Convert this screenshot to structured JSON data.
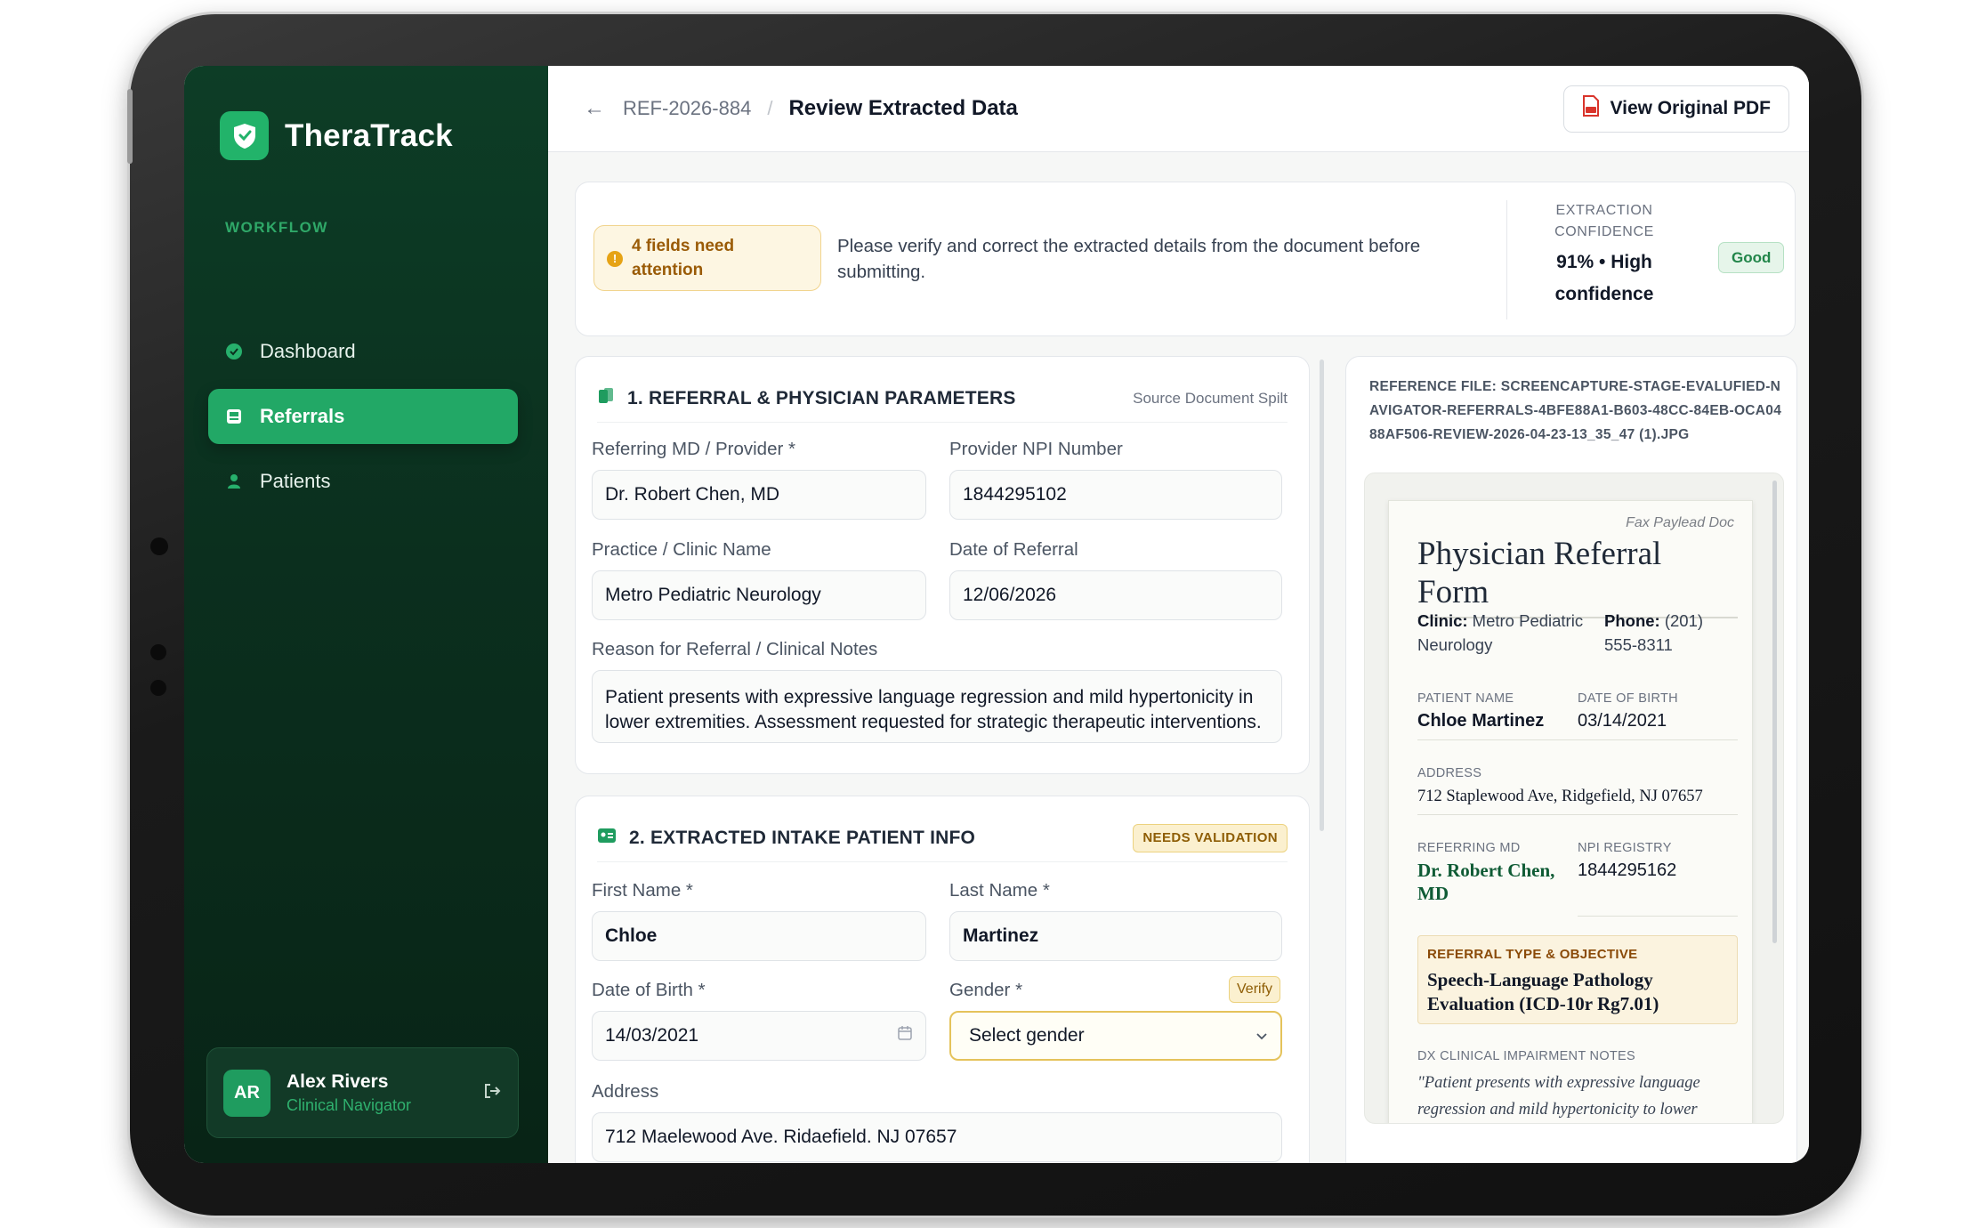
{
  "app": {
    "name": "TheraTrack"
  },
  "nav": {
    "section_label": "WORKFLOW",
    "items": [
      {
        "label": "Dashboard",
        "icon": "check-circle-icon"
      },
      {
        "label": "Referrals",
        "icon": "inbox-icon",
        "active": true
      },
      {
        "label": "Patients",
        "icon": "user-icon"
      }
    ]
  },
  "user": {
    "initials": "AR",
    "name": "Alex Rivers",
    "role": "Clinical Navigator"
  },
  "header": {
    "ref_id": "REF-2026-884",
    "separator": "/",
    "title": "Review Extracted Data",
    "pdf_button": "View Original PDF"
  },
  "alert": {
    "badge": "4 fields need attention",
    "message": "Please verify and correct the extracted details from the document before submitting.",
    "confidence_label": "EXTRACTION CONFIDENCE",
    "confidence_value": "91% • High confidence",
    "confidence_badge": "Good"
  },
  "section1": {
    "title": "1. REFERRAL & PHYSICIAN PARAMETERS",
    "note": "Source Document Spilt",
    "fields": {
      "referring_md_label": "Referring MD / Provider *",
      "referring_md_value": "Dr. Robert Chen, MD",
      "npi_label": "Provider NPI Number",
      "npi_value": "1844295102",
      "practice_label": "Practice / Clinic Name",
      "practice_value": "Metro Pediatric Neurology",
      "date_label": "Date of Referral",
      "date_value": "12/06/2026",
      "reason_label": "Reason for Referral / Clinical Notes",
      "reason_value": "Patient presents with expressive language regression and mild hypertonicity in lower extremities. Assessment requested for strategic therapeutic interventions."
    }
  },
  "section2": {
    "title": "2. EXTRACTED INTAKE PATIENT INFO",
    "badge": "NEEDS VALIDATION",
    "fields": {
      "first_name_label": "First Name *",
      "first_name_value": "Chloe",
      "last_name_label": "Last Name *",
      "last_name_value": "Martinez",
      "dob_label": "Date of Birth *",
      "dob_value": "14/03/2021",
      "gender_label": "Gender *",
      "gender_verify": "Verify",
      "gender_placeholder": "Select gender",
      "address_label": "Address",
      "address_value": "712 Maelewood Ave. Ridaefield. NJ 07657"
    }
  },
  "reference": {
    "file": "REFERENCE FILE: SCREENCAPTURE-STAGE-EVALUFIED-NAVIGATOR-REFERRALS-4BFE88A1-B603-48CC-84EB-OCA0488AF506-REVIEW-2026-04-23-13_35_47 (1).JPG",
    "doc": {
      "tag": "Fax Paylead Doc",
      "title": "Physician Referral Form",
      "clinic_label": "Clinic:",
      "clinic_value": "Metro Pediatric Neurology",
      "phone_label": "Phone:",
      "phone_value": "(201) 555-8311",
      "patient_name_label": "PATIENT NAME",
      "patient_name_value": "Chloe Martinez",
      "dob_label": "DATE OF BIRTH",
      "dob_value": "03/14/2021",
      "address_label": "ADDRESS",
      "address_value": "712 Staplewood Ave, Ridgefield, NJ 07657",
      "referring_label": "REFERRING MD",
      "referring_value": "Dr. Robert Chen, MD",
      "npi_label": "NPI REGISTRY",
      "npi_value": "1844295162",
      "type_label": "REFERRAL TYPE & OBJECTIVE",
      "type_value": "Speech-Language Pathology Evaluation (ICD-10r Rg7.01)",
      "notes_label": "DX CLINICAL IMPAIRMENT NOTES",
      "notes_value": "\"Patient presents with expressive language regression and mild hypertonicity to lower"
    }
  },
  "colors": {
    "brand": "#22a866",
    "sidebar": "#0b2f1e",
    "warning": "#e6a315"
  }
}
